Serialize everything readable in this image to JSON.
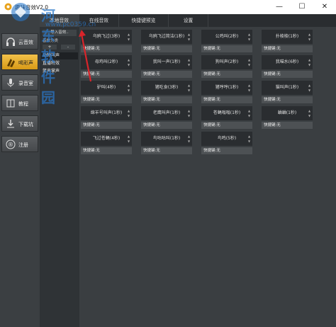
{
  "window": {
    "title": "趣味音效V2.0",
    "controls": {
      "minimize": "—",
      "maximize": "☐",
      "close": "✕"
    }
  },
  "sidebar": {
    "items": [
      {
        "label": "云音效",
        "icon": "headphones-icon",
        "active": false
      },
      {
        "label": "喝彩声",
        "icon": "applause-icon",
        "active": true
      },
      {
        "label": "录音室",
        "icon": "microphone-icon",
        "active": false
      },
      {
        "label": "教程",
        "icon": "book-icon",
        "active": false
      },
      {
        "label": "下载坑",
        "icon": "download-icon",
        "active": false
      },
      {
        "label": "注册",
        "icon": "register-icon",
        "active": false
      }
    ]
  },
  "categories": {
    "import_label": "导入音效..",
    "group_label": "音效分类",
    "add": "+",
    "remove": "-",
    "items": [
      {
        "label": "动物叫声",
        "selected": true
      },
      {
        "label": "直播特效",
        "selected": false
      },
      {
        "label": "笑声掌声",
        "selected": false
      }
    ]
  },
  "tabs": [
    {
      "label": "本地音效",
      "active": true
    },
    {
      "label": "在线音效",
      "active": false
    },
    {
      "label": "快捷键预览",
      "active": false
    },
    {
      "label": "设置",
      "active": false
    }
  ],
  "sounds": [
    {
      "name": "乌鸦飞过(3秒)",
      "hotkey": "快捷键:无"
    },
    {
      "name": "乌鸦飞过简洁(1秒)",
      "hotkey": "快捷键:无"
    },
    {
      "name": "公鸡叫(2秒)",
      "hotkey": "快捷键:无"
    },
    {
      "name": "扑棱棱(1秒)",
      "hotkey": "快捷键:无"
    },
    {
      "name": "母鸡叫(2秒)",
      "hotkey": "快捷键:无"
    },
    {
      "name": "我叫一声(1秒)",
      "hotkey": "快捷键:无"
    },
    {
      "name": "狗叫声(2秒)",
      "hotkey": "快捷键:无"
    },
    {
      "name": "我喵水(6秒)",
      "hotkey": "快捷键:无"
    },
    {
      "name": "驴叫(4秒)",
      "hotkey": "快捷键:无"
    },
    {
      "name": "猪吃食(3秒)",
      "hotkey": "快捷键:无"
    },
    {
      "name": "猪哼哼(1秒)",
      "hotkey": "快捷键:无"
    },
    {
      "name": "猫叫声(1秒)",
      "hotkey": "快捷键:无"
    },
    {
      "name": "绵羊号叫声(1秒)",
      "hotkey": "快捷键:无"
    },
    {
      "name": "老鹰叫声(1秒)",
      "hotkey": "快捷键:无"
    },
    {
      "name": "苍蝇嗡嗡(1秒)",
      "hotkey": "快捷键:无"
    },
    {
      "name": "蛐蛐(1秒)",
      "hotkey": "快捷键:无"
    },
    {
      "name": "飞过苍蝇(4秒)",
      "hotkey": "快捷键:无"
    },
    {
      "name": "鸟咕咕叫(1秒)",
      "hotkey": "快捷键:无"
    },
    {
      "name": "鸟鸣(5秒)",
      "hotkey": "快捷键:无"
    }
  ],
  "arrows": {
    "up": "▲",
    "down": "▼"
  },
  "watermark": {
    "text": "河东软件园",
    "url": "www.pc0359.cn"
  },
  "colors": {
    "active_nav": "#f0b429",
    "panel": "#3a3e41",
    "card": "#2a2d30",
    "hotkey_bar": "#4d5154"
  }
}
